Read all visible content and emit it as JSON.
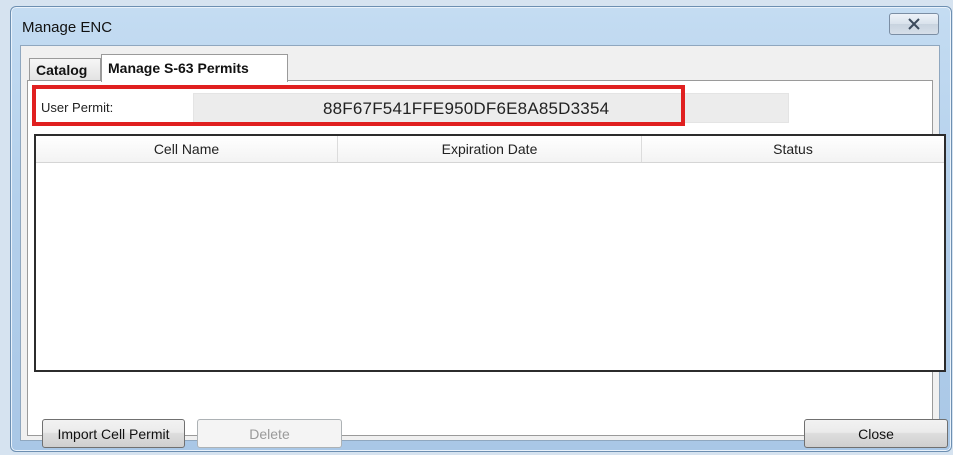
{
  "window": {
    "title": "Manage ENC",
    "close_icon": "close-icon"
  },
  "tabs": [
    {
      "label": "Catalog",
      "active": false
    },
    {
      "label": "Manage S-63 Permits",
      "active": true
    }
  ],
  "permit": {
    "label": "User Permit:",
    "value": "88F67F541FFE950DF6E8A85D3354",
    "highlight_color": "#e02020"
  },
  "table": {
    "columns": [
      "Cell Name",
      "Expiration Date",
      "Status"
    ],
    "rows": []
  },
  "buttons": {
    "import_label": "Import Cell Permit",
    "delete_label": "Delete",
    "close_label": "Close"
  }
}
